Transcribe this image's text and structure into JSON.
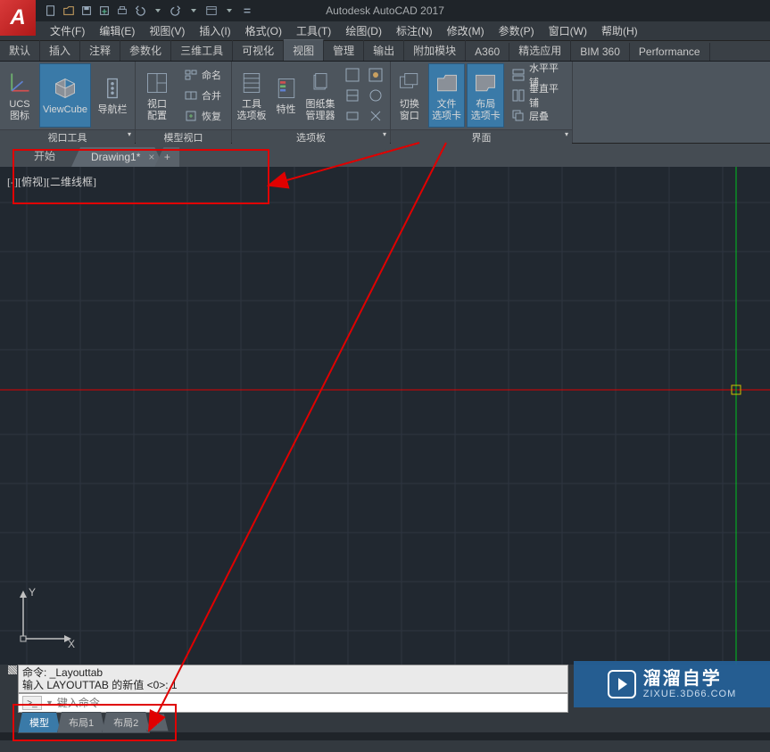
{
  "app": {
    "title": "Autodesk AutoCAD 2017",
    "logo_letter": "A"
  },
  "menu": [
    "文件(F)",
    "编辑(E)",
    "视图(V)",
    "插入(I)",
    "格式(O)",
    "工具(T)",
    "绘图(D)",
    "标注(N)",
    "修改(M)",
    "参数(P)",
    "窗口(W)",
    "帮助(H)"
  ],
  "ribbon_tabs": [
    "默认",
    "插入",
    "注释",
    "参数化",
    "三维工具",
    "可视化",
    "视图",
    "管理",
    "输出",
    "附加模块",
    "A360",
    "精选应用",
    "BIM 360",
    "Performance"
  ],
  "ribbon_active": "视图",
  "panels": {
    "view_tools": {
      "title": "视口工具",
      "ucs": "UCS\n图标",
      "viewcube": "ViewCube",
      "navbar": "导航栏"
    },
    "model_viewport": {
      "title": "模型视口",
      "config": "视口\n配置",
      "named": "命名",
      "merge": "合并",
      "restore": "恢复"
    },
    "palettes": {
      "title": "选项板",
      "tool_palettes": "工具\n选项板",
      "properties": "特性",
      "sheetset": "图纸集\n管理器"
    },
    "ui": {
      "title": "界面",
      "switch_windows": "切换\n窗口",
      "file_tabs": "文件\n选项卡",
      "layout_tabs": "布局\n选项卡",
      "tile_h": "水平平铺",
      "tile_v": "垂直平铺",
      "cascade": "层叠"
    }
  },
  "filetabs": {
    "start": "开始",
    "active": "Drawing1*",
    "plus": "+"
  },
  "view_label": "[-][俯视][二维线框]",
  "ucs_axes": {
    "x": "X",
    "y": "Y"
  },
  "cmd_hist": {
    "line1": "命令: _Layouttab",
    "line2": "输入 LAYOUTTAB 的新值 <0>: 1"
  },
  "cmdline": {
    "prompt": ">_",
    "placeholder": "键入命令"
  },
  "layout_tabs": {
    "model": "模型",
    "l1": "布局1",
    "l2": "布局2",
    "plus": "+"
  },
  "status": {
    "coords": ""
  },
  "watermark": {
    "name": "溜溜自学",
    "url": "ZIXUE.3D66.COM"
  }
}
